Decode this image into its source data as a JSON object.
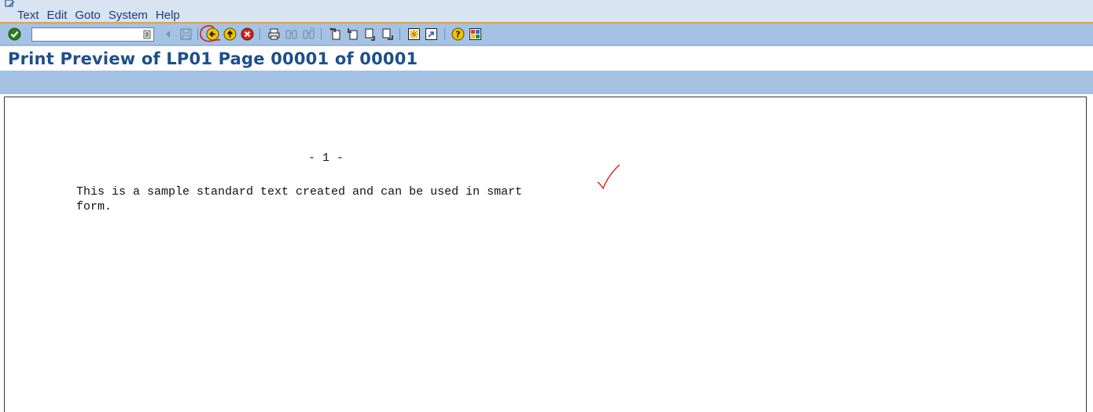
{
  "menu": {
    "items": [
      {
        "label": "Text"
      },
      {
        "label": "Edit"
      },
      {
        "label": "Goto"
      },
      {
        "label": "System"
      },
      {
        "label": "Help"
      }
    ]
  },
  "toolbar": {
    "command_field_value": "",
    "icons": [
      "enter-icon",
      "history-dropdown-icon",
      "nav-back-arrow-icon",
      "save-icon",
      "back-icon",
      "exit-icon",
      "cancel-icon",
      "print-icon",
      "find-icon",
      "find-next-icon",
      "first-page-icon",
      "previous-page-icon",
      "next-page-icon",
      "last-page-icon",
      "create-session-icon",
      "create-shortcut-icon",
      "help-icon",
      "customize-layout-icon"
    ]
  },
  "title": {
    "text": "Print Preview of LP01 Page 00001 of 00001"
  },
  "document": {
    "page_number": "- 1 -",
    "line1": "This is a sample standard text created and can be used in smart",
    "line2": "form."
  },
  "colors": {
    "menubar_bg": "#d9e4f2",
    "toolbar_bg": "#a4c2e4",
    "accent_line": "#e8a033",
    "title_text": "#1d4f8a",
    "annotation_red": "#e01818"
  }
}
